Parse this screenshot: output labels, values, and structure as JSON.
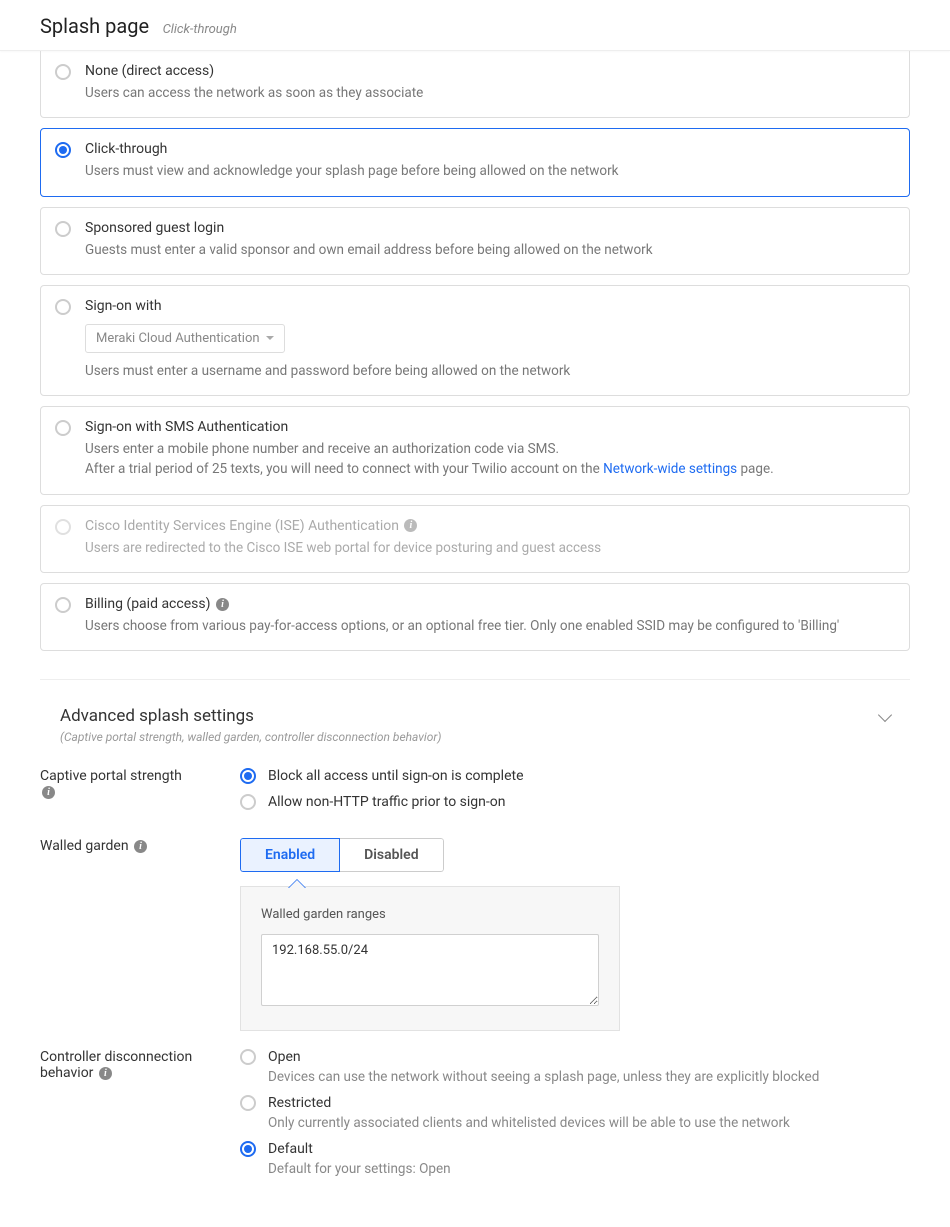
{
  "header": {
    "title": "Splash page",
    "subtitle": "Click-through"
  },
  "options": {
    "none": {
      "title": "None (direct access)",
      "desc": "Users can access the network as soon as they associate"
    },
    "click": {
      "title": "Click-through",
      "desc": "Users must view and acknowledge your splash page before being allowed on the network"
    },
    "sponsored": {
      "title": "Sponsored guest login",
      "desc": "Guests must enter a valid sponsor and own email address before being allowed on the network"
    },
    "signon": {
      "title": "Sign-on with",
      "dropdown": "Meraki Cloud Authentication",
      "desc": "Users must enter a username and password before being allowed on the network"
    },
    "sms": {
      "title": "Sign-on with SMS Authentication",
      "desc1": "Users enter a mobile phone number and receive an authorization code via SMS.",
      "desc2a": "After a trial period of 25 texts, you will need to connect with your Twilio account on the ",
      "link": "Network-wide settings",
      "desc2b": " page."
    },
    "ise": {
      "title": "Cisco Identity Services Engine (ISE) Authentication",
      "desc": "Users are redirected to the Cisco ISE web portal for device posturing and guest access"
    },
    "billing": {
      "title": "Billing (paid access)",
      "desc": "Users choose from various pay-for-access options, or an optional free tier. Only one enabled SSID may be configured to 'Billing'"
    }
  },
  "advanced": {
    "title": "Advanced splash settings",
    "sub": "(Captive portal strength, walled garden, controller disconnection behavior)"
  },
  "captive": {
    "label": "Captive portal strength",
    "block": "Block all access until sign-on is complete",
    "allow": "Allow non-HTTP traffic prior to sign-on"
  },
  "walled": {
    "label": "Walled garden",
    "enabled": "Enabled",
    "disabled": "Disabled",
    "panel_label": "Walled garden ranges",
    "ranges": "192.168.55.0/24"
  },
  "controller": {
    "label": "Controller disconnection behavior",
    "open_t": "Open",
    "open_d": "Devices can use the network without seeing a splash page, unless they are explicitly blocked",
    "restr_t": "Restricted",
    "restr_d": "Only currently associated clients and whitelisted devices will be able to use the network",
    "def_t": "Default",
    "def_d": "Default for your settings: Open"
  }
}
